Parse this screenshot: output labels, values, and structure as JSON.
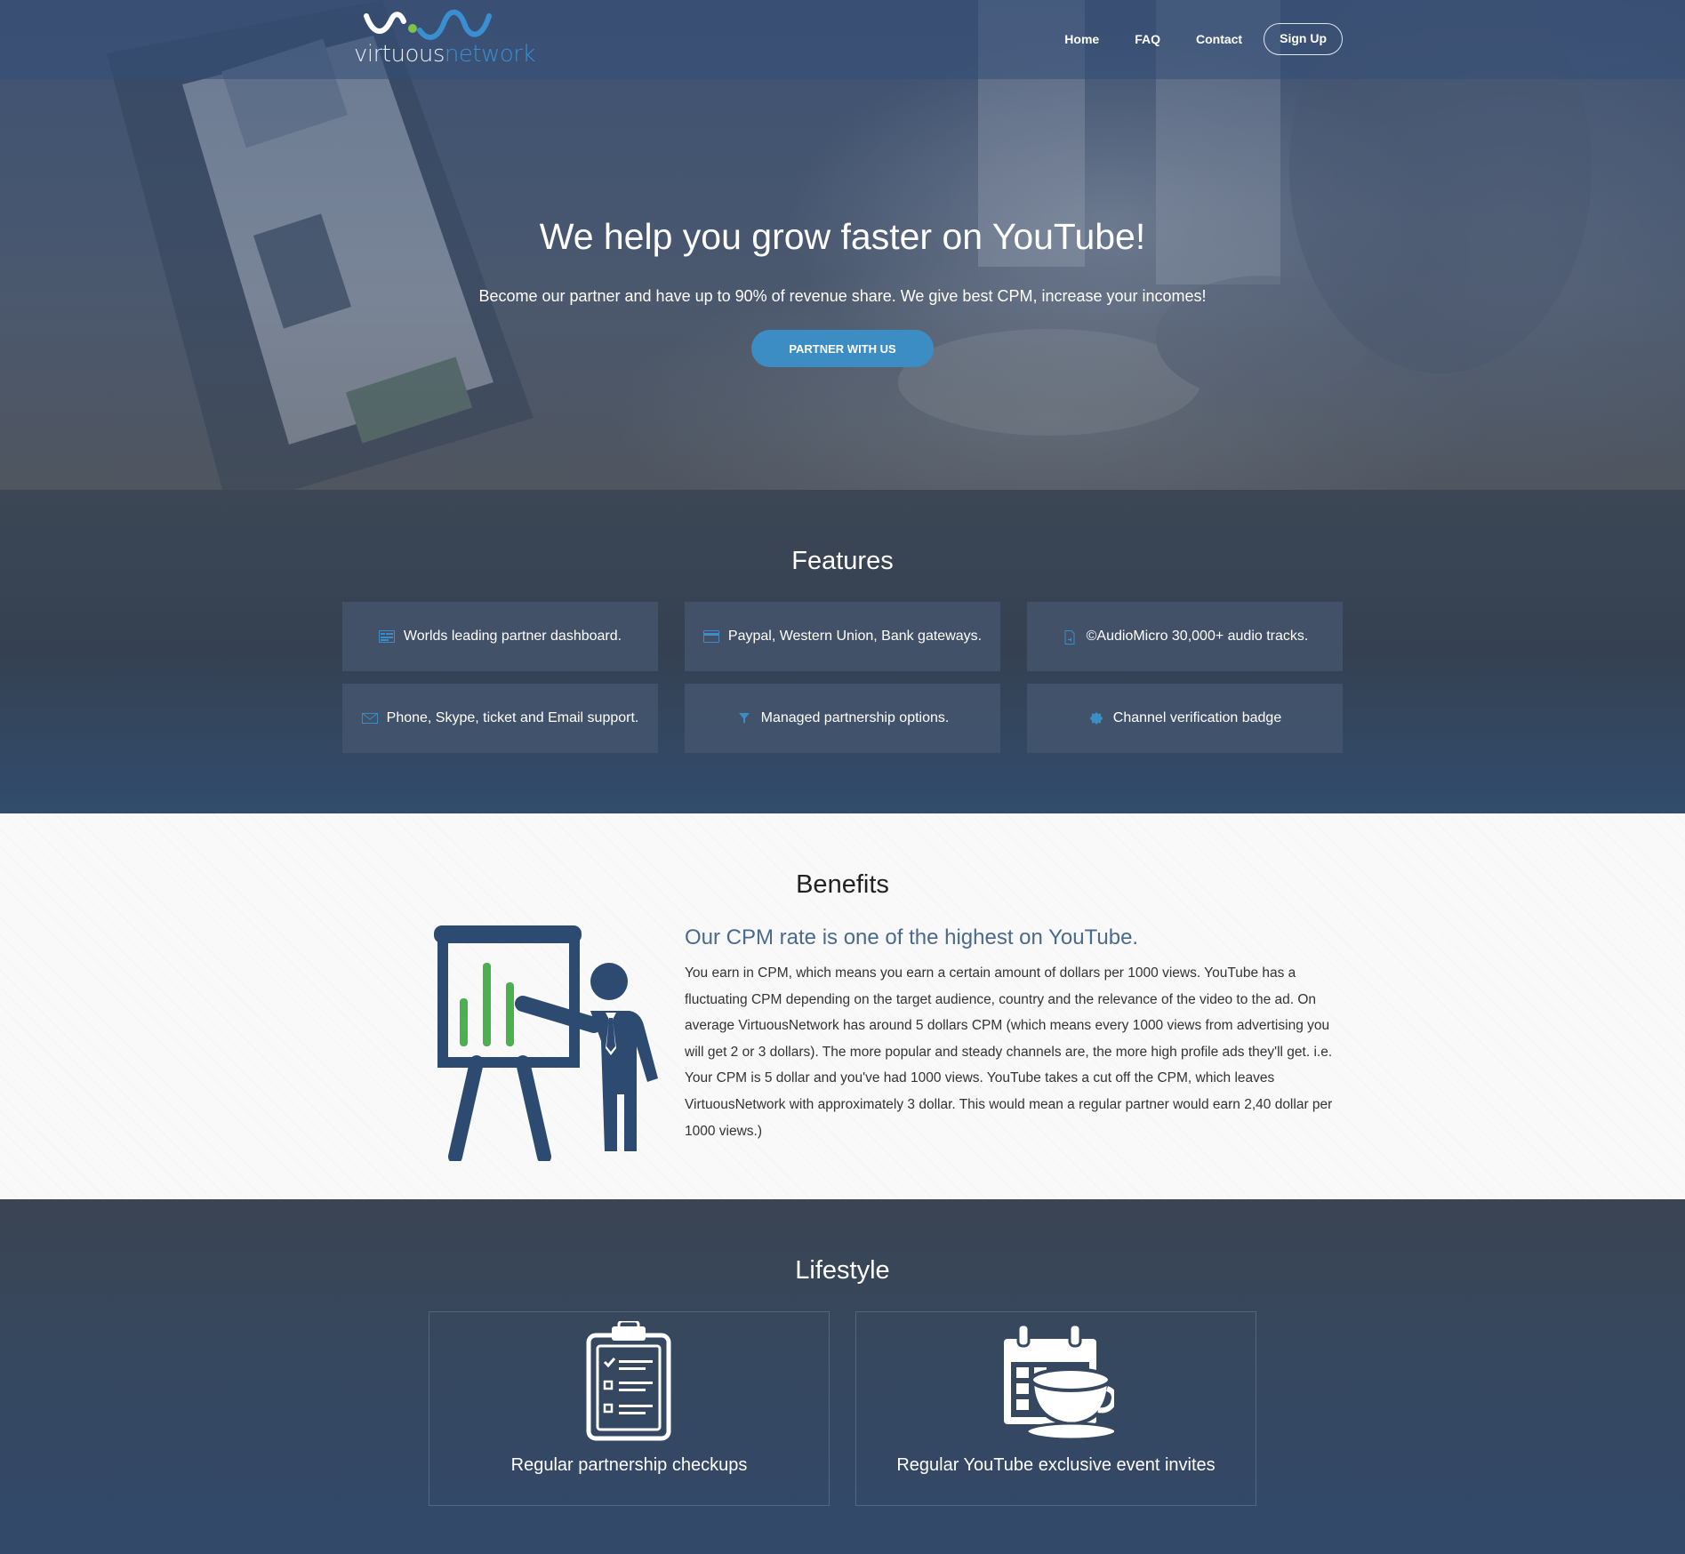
{
  "brand": {
    "name_part1": "virtuous",
    "name_part2": "network"
  },
  "nav": {
    "items": [
      {
        "label": "Home"
      },
      {
        "label": "FAQ"
      },
      {
        "label": "Contact"
      }
    ],
    "signup_label": "Sign Up"
  },
  "hero": {
    "title": "We help you grow faster on YouTube!",
    "subtitle": "Become our partner and have up to 90% of revenue share. We give best CPM, increase your incomes!",
    "cta_label": "PARTNER WITH US"
  },
  "features": {
    "title": "Features",
    "items": [
      {
        "icon": "dashboard-icon",
        "label": "Worlds leading partner dashboard."
      },
      {
        "icon": "credit-card-icon",
        "label": "Paypal, Western Union, Bank gateways."
      },
      {
        "icon": "audio-file-icon",
        "label": "©AudioMicro 30,000+ audio tracks."
      },
      {
        "icon": "envelope-icon",
        "label": "Phone, Skype, ticket and Email support."
      },
      {
        "icon": "filter-icon",
        "label": "Managed partnership options."
      },
      {
        "icon": "badge-icon",
        "label": "Channel verification badge"
      }
    ]
  },
  "benefits": {
    "title": "Benefits",
    "headline": "Our CPM rate is one of the highest on YouTube.",
    "body": "You earn in CPM, which means you earn a certain amount of dollars per 1000 views. YouTube has a fluctuating CPM depending on the target audience, country and the relevance of the video to the ad. On average VirtuousNetwork has around 5 dollars CPM (which means every 1000 views from advertising you will get 2 or 3 dollars). The more popular and steady channels are, the more high profile ads they'll get. i.e. Your CPM is 5 dollar and you've had 1000 views. YouTube takes a cut off the CPM, which leaves VirtuousNetwork with approximately 3 dollar. This would mean a regular partner would earn 2,40 dollar per 1000 views.)"
  },
  "lifestyle": {
    "title": "Lifestyle",
    "items": [
      {
        "icon": "clipboard-checklist-icon",
        "label": "Regular partnership checkups"
      },
      {
        "icon": "calendar-coffee-icon",
        "label": "Regular YouTube exclusive event invites"
      }
    ]
  },
  "colors": {
    "accent": "#3c8dc3",
    "headline_blue": "#4a6a8e",
    "nav_bg": "#344e76",
    "presenter_navy": "#2d4a70",
    "chart_green": "#4caf50"
  }
}
